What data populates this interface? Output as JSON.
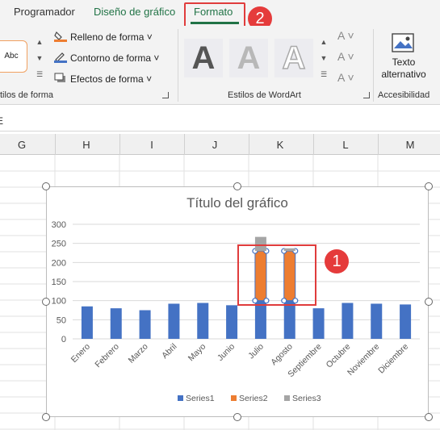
{
  "tabs": [
    {
      "label": "Programador",
      "state": "normal"
    },
    {
      "label": "Diseño de gráfico",
      "state": "normal"
    },
    {
      "label": "Formato",
      "state": "active"
    }
  ],
  "callouts": {
    "tab_callout": "2",
    "chart_callout": "1"
  },
  "ribbon": {
    "shape_style_preview": "Abc",
    "commands": {
      "fill": "Relleno de forma",
      "outline": "Contorno de forma",
      "effects": "Efectos de forma"
    },
    "group_shape_styles": "tilos de forma",
    "wordart_letter": "A",
    "group_wordart": "Estilos de WordArt",
    "alt_text_label_1": "Texto",
    "alt_text_label_2": "alternativo",
    "group_accessibility": "Accesibilidad",
    "dropdown_glyph": "˅"
  },
  "formula_bar": {
    "name_box_fragment": "E"
  },
  "columns": [
    "G",
    "H",
    "I",
    "J",
    "K",
    "L",
    "M"
  ],
  "colors": {
    "series1": "#4472C4",
    "series2": "#ED7D31",
    "series3": "#A5A5A5",
    "accent_red": "#E53B3B",
    "excel_green": "#217346"
  },
  "chart_data": {
    "type": "bar",
    "title": "Título del gráfico",
    "categories": [
      "Enero",
      "Febrero",
      "Marzo",
      "Abril",
      "Mayo",
      "Junio",
      "Julio",
      "Agosto",
      "Septiembre",
      "Octubre",
      "Noviembre",
      "Diciembre"
    ],
    "y_ticks": [
      "0",
      "50",
      "100",
      "150",
      "200",
      "250",
      "300"
    ],
    "ylim": [
      0,
      300
    ],
    "stacked": true,
    "series": [
      {
        "name": "Series1",
        "values": [
          85,
          80,
          75,
          92,
          94,
          88,
          100,
          100,
          80,
          94,
          92,
          90
        ]
      },
      {
        "name": "Series2",
        "values": [
          null,
          null,
          null,
          null,
          null,
          null,
          130,
          130,
          null,
          null,
          null,
          null
        ]
      },
      {
        "name": "Series3",
        "values": [
          null,
          null,
          null,
          null,
          null,
          null,
          37,
          7,
          null,
          null,
          null,
          null
        ]
      }
    ],
    "legend_position": "bottom",
    "gridlines": true,
    "selected_series": "Series2"
  }
}
